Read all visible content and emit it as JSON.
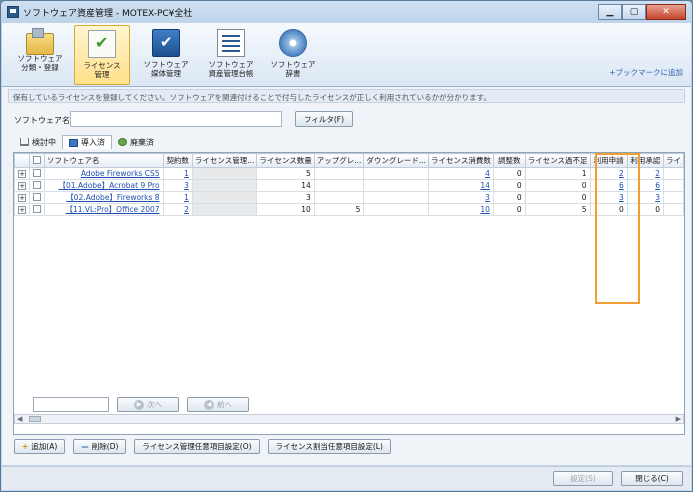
{
  "window": {
    "title": "ソフトウェア資産管理 - MOTEX-PC¥全社"
  },
  "ribbon": {
    "buttons": [
      {
        "label": "ソフトウェア\n分類・登録",
        "icon": "folder-icon"
      },
      {
        "label": "ライセンス\n管理",
        "icon": "license-check-icon",
        "active": true
      },
      {
        "label": "ソフトウェア\n媒体管理",
        "icon": "media-icon"
      },
      {
        "label": "ソフトウェア\n資産管理台帳",
        "icon": "ledger-icon"
      },
      {
        "label": "ソフトウェア\n辞書",
        "icon": "disc-icon"
      }
    ],
    "bookmark": "+ブックマークに追加"
  },
  "description": "保有しているライセンスを登録してください。ソフトウェアを関連付けることで付与したライセンスが正しく利用されているかが分かります。",
  "search": {
    "label": "ソフトウェア名",
    "value": "",
    "filter_label": "フィルタ(F)"
  },
  "tabs": [
    {
      "label": "検討中",
      "icon": "cart-icon"
    },
    {
      "label": "導入済",
      "icon": "installed-icon",
      "active": true
    },
    {
      "label": "廃棄済",
      "icon": "disposed-icon"
    }
  ],
  "grid": {
    "columns": [
      "",
      "",
      "ソフトウェア名",
      "契約数",
      "ライセンス管理...",
      "ライセンス数量",
      "アップグレ...",
      "ダウングレード...",
      "ライセンス消費数",
      "調整数",
      "ライセンス過不足",
      "利用申請",
      "利用承認",
      "ライ"
    ],
    "rows": [
      {
        "name": "Adobe Fireworks CS5",
        "contracts": "1",
        "mgmt": "",
        "qty": "5",
        "upgrade": "",
        "downgrade": "",
        "consumed": "4",
        "adjust": "0",
        "surplus": "1",
        "apply": "2",
        "approve": "2"
      },
      {
        "name": "【01.Adobe】Acrobat 9 Pro",
        "contracts": "3",
        "mgmt": "",
        "qty": "14",
        "upgrade": "",
        "downgrade": "",
        "consumed": "14",
        "adjust": "0",
        "surplus": "0",
        "apply": "6",
        "approve": "6"
      },
      {
        "name": "【02.Adobe】Fireworks 8",
        "contracts": "1",
        "mgmt": "",
        "qty": "3",
        "upgrade": "",
        "downgrade": "",
        "consumed": "3",
        "adjust": "0",
        "surplus": "0",
        "apply": "3",
        "approve": "3"
      },
      {
        "name": "【11.VL:Pro】Office 2007",
        "contracts": "2",
        "mgmt": "",
        "qty": "10",
        "upgrade": "5",
        "downgrade": "",
        "consumed": "10",
        "adjust": "0",
        "surplus": "5",
        "apply": "0",
        "approve": "0"
      }
    ]
  },
  "pager": {
    "value": "",
    "next_label": "次へ",
    "prev_label": "前へ"
  },
  "actions": {
    "add": "追加(A)",
    "delete": "削除(D)",
    "license_mgmt": "ライセンス管理任意項目設定(O)",
    "license_assign": "ライセンス割当任意項目設定(L)"
  },
  "footer": {
    "settings": "設定(S)",
    "close": "閉じる(C)"
  },
  "colors": {
    "highlight": "#f0a032",
    "link": "#1f4fb0"
  }
}
